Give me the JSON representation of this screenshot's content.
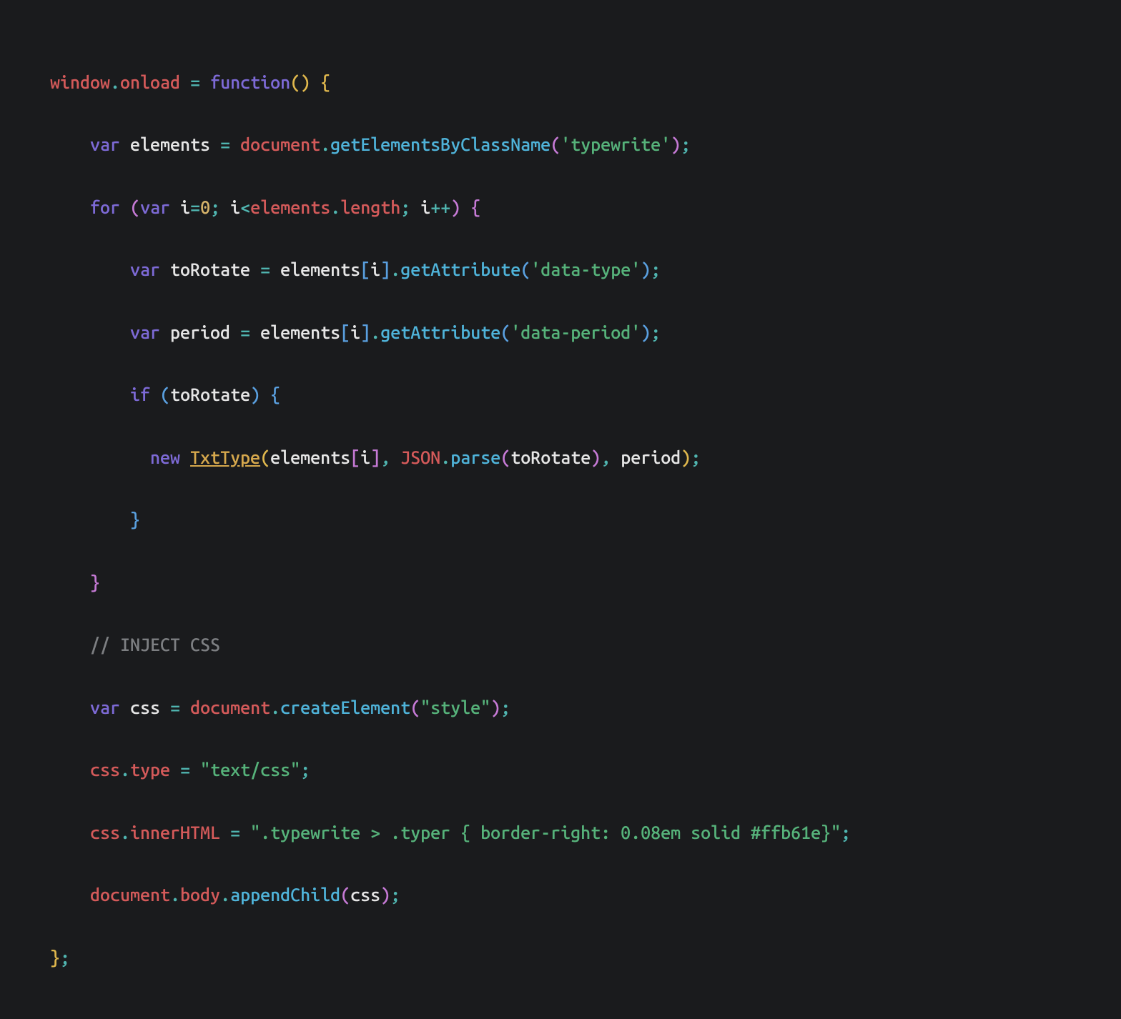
{
  "code": {
    "l1": {
      "window": "window",
      "dot1": ".",
      "onload": "onload",
      "sp1": " ",
      "eq": "=",
      "sp2": " ",
      "func": "function",
      "par1": "(",
      "par2": ")",
      "sp3": " ",
      "brace": "{"
    },
    "l2": {
      "indent": "    ",
      "var": "var",
      "sp1": " ",
      "elements": "elements",
      "sp2": " ",
      "eq": "=",
      "sp3": " ",
      "document": "document",
      "dot": ".",
      "method": "getElementsByClassName",
      "par1": "(",
      "str": "'typewrite'",
      "par2": ")",
      "semi": ";"
    },
    "l3": {
      "indent": "    ",
      "for": "for",
      "sp1": " ",
      "par1": "(",
      "var": "var",
      "sp2": " ",
      "i": "i",
      "eq": "=",
      "zero": "0",
      "semi1": ";",
      "sp3": " ",
      "i2": "i",
      "lt": "<",
      "elements": "elements",
      "dot": ".",
      "length": "length",
      "semi2": ";",
      "sp4": " ",
      "i3": "i",
      "inc": "++",
      "par2": ")",
      "sp5": " ",
      "brace": "{"
    },
    "l4": {
      "indent": "        ",
      "var": "var",
      "sp1": " ",
      "toRotate": "toRotate",
      "sp2": " ",
      "eq": "=",
      "sp3": " ",
      "elements": "elements",
      "br1": "[",
      "i": "i",
      "br2": "]",
      "dot": ".",
      "method": "getAttribute",
      "par1": "(",
      "str": "'data-type'",
      "par2": ")",
      "semi": ";"
    },
    "l5": {
      "indent": "        ",
      "var": "var",
      "sp1": " ",
      "period": "period",
      "sp2": " ",
      "eq": "=",
      "sp3": " ",
      "elements": "elements",
      "br1": "[",
      "i": "i",
      "br2": "]",
      "dot": ".",
      "method": "getAttribute",
      "par1": "(",
      "str": "'data-period'",
      "par2": ")",
      "semi": ";"
    },
    "l6": {
      "indent": "        ",
      "if": "if",
      "sp1": " ",
      "par1": "(",
      "toRotate": "toRotate",
      "par2": ")",
      "sp2": " ",
      "brace": "{"
    },
    "l7": {
      "indent": "          ",
      "new": "new",
      "sp1": " ",
      "TxtType": "TxtType",
      "par1": "(",
      "elements": "elements",
      "br1": "[",
      "i": "i",
      "br2": "]",
      "comma1": ",",
      "sp2": " ",
      "JSON": "JSON",
      "dot": ".",
      "parse": "parse",
      "par3": "(",
      "toRotate": "toRotate",
      "par4": ")",
      "comma2": ",",
      "sp3": " ",
      "period": "period",
      "par2": ")",
      "semi": ";"
    },
    "l8": {
      "indent": "        ",
      "brace": "}"
    },
    "l9": {
      "indent": "    ",
      "brace": "}"
    },
    "l10": {
      "indent": "    ",
      "comment": "// INJECT CSS"
    },
    "l11": {
      "indent": "    ",
      "var": "var",
      "sp1": " ",
      "css": "css",
      "sp2": " ",
      "eq": "=",
      "sp3": " ",
      "document": "document",
      "dot": ".",
      "method": "createElement",
      "par1": "(",
      "str": "\"style\"",
      "par2": ")",
      "semi": ";"
    },
    "l12": {
      "indent": "    ",
      "css": "css",
      "dot": ".",
      "type": "type",
      "sp1": " ",
      "eq": "=",
      "sp2": " ",
      "str": "\"text/css\"",
      "semi": ";"
    },
    "l13": {
      "indent": "    ",
      "css": "css",
      "dot": ".",
      "innerHTML": "innerHTML",
      "sp1": " ",
      "eq": "=",
      "sp2": " ",
      "str": "\".typewrite > .typer { border-right: 0.08em solid #ffb61e}\"",
      "semi": ";"
    },
    "l14": {
      "indent": "    ",
      "document": "document",
      "dot1": ".",
      "body": "body",
      "dot2": ".",
      "method": "appendChild",
      "par1": "(",
      "css": "css",
      "par2": ")",
      "semi": ";"
    },
    "l15": {
      "brace": "}",
      "semi": ";"
    }
  }
}
